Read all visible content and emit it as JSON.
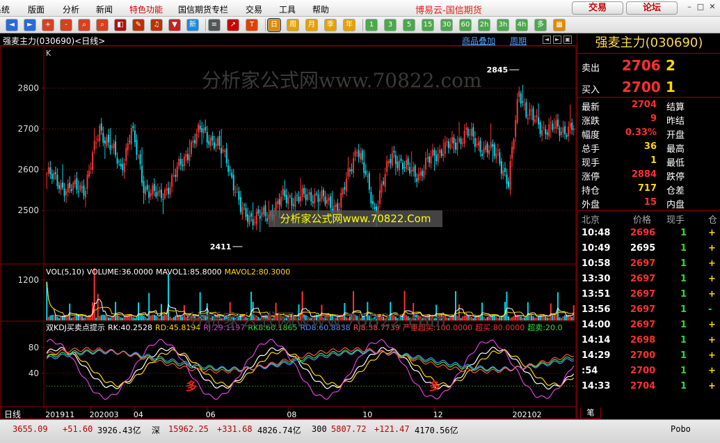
{
  "menu": [
    {
      "label": "系统",
      "x": -10
    },
    {
      "label": "版面",
      "x": 40
    },
    {
      "label": "分析",
      "x": 90
    },
    {
      "label": "新闻",
      "x": 138
    },
    {
      "label": "特色功能",
      "x": 186,
      "color": "#d00000"
    },
    {
      "label": "国信期货专栏",
      "x": 256
    },
    {
      "label": "交易",
      "x": 353
    },
    {
      "label": "工具",
      "x": 401
    },
    {
      "label": "帮助",
      "x": 449
    }
  ],
  "brand": "博易云-国信期货",
  "buttons": {
    "trade": "交易",
    "forum": "论坛"
  },
  "toolbar_icons": [
    {
      "name": "back-icon",
      "glyph": "◄",
      "color": "#2a6ad8"
    },
    {
      "name": "forward-icon",
      "glyph": "►",
      "color": "#2a6ad8"
    },
    {
      "name": "zoom-in-icon",
      "glyph": "+",
      "color": "#d84020"
    },
    {
      "name": "zoom-out-icon",
      "glyph": "-",
      "color": "#d84020"
    },
    {
      "name": "search-icon",
      "glyph": "⌕",
      "color": "#d84020"
    },
    {
      "name": "find-icon",
      "glyph": "⌕",
      "color": "#d84020"
    },
    {
      "name": "color-icon",
      "glyph": "◧",
      "color": "#b01010"
    },
    {
      "name": "pen-icon",
      "glyph": "✎",
      "color": "#c03000"
    },
    {
      "name": "alarm-icon",
      "glyph": "♫",
      "color": "#c03000"
    },
    {
      "name": "filter-icon",
      "glyph": "▼",
      "color": "#c82020"
    },
    {
      "name": "new-icon",
      "glyph": "新",
      "color": "#1b8ad8"
    },
    {
      "name": "list-icon",
      "glyph": "≡",
      "color": "#555"
    },
    {
      "name": "trend-icon",
      "glyph": "↗",
      "color": "#c00"
    },
    {
      "name": "tick-icon",
      "glyph": "T",
      "color": "#e04000"
    },
    {
      "name": "day-icon",
      "glyph": "日",
      "color": "#e08a00"
    },
    {
      "name": "week-icon",
      "glyph": "周",
      "color": "#e8a000"
    },
    {
      "name": "month-icon",
      "glyph": "月",
      "color": "#e8a000"
    },
    {
      "name": "season-icon",
      "glyph": "季",
      "color": "#e8a000"
    },
    {
      "name": "year-icon",
      "glyph": "年",
      "color": "#e8a000"
    },
    {
      "name": "min1-icon",
      "glyph": "1",
      "color": "#4ca84c"
    },
    {
      "name": "min3-icon",
      "glyph": "3",
      "color": "#4ca84c"
    },
    {
      "name": "min5-icon",
      "glyph": "5",
      "color": "#4ca84c"
    },
    {
      "name": "min15-icon",
      "glyph": "15",
      "color": "#4ca84c"
    },
    {
      "name": "min30-icon",
      "glyph": "30",
      "color": "#4ca84c"
    },
    {
      "name": "min60-icon",
      "glyph": "60",
      "color": "#4ca84c"
    },
    {
      "name": "hour2-icon",
      "glyph": "2h",
      "color": "#4ca84c"
    },
    {
      "name": "hour3-icon",
      "glyph": "3h",
      "color": "#4ca84c"
    },
    {
      "name": "hour4-icon",
      "glyph": "4h",
      "color": "#4ca84c"
    },
    {
      "name": "multi-icon",
      "glyph": "多",
      "color": "#4ca84c"
    },
    {
      "name": "layout-icon",
      "glyph": "▦",
      "color": "#e08a00"
    }
  ],
  "chart_header": {
    "title": "强麦主力(030690)<日线>",
    "links": [
      "商品叠加",
      "周期"
    ]
  },
  "watermark": {
    "badge": "分析家公式网www.70822.Com",
    "text1": "分析家公式网www.70822.com",
    "text2": "分析家公式网www.70822.com"
  },
  "colors": {
    "up": "#ff3232",
    "down": "#00d8e8",
    "red": "#ff3030",
    "green": "#2fdc2f",
    "yellow": "#ffd800",
    "frame": "#900000"
  },
  "chart_data": [
    {
      "type": "candlestick",
      "panel_label": "K",
      "ylim": [
        2370,
        2900
      ],
      "yticks": [
        2500,
        2600,
        2700,
        2800
      ],
      "annotations": [
        {
          "label": "2845",
          "value": 2845,
          "index": 268
        },
        {
          "label": "2411",
          "value": 2411,
          "index": 111
        }
      ],
      "anchors": [
        [
          0,
          2590
        ],
        [
          12,
          2550
        ],
        [
          22,
          2560
        ],
        [
          30,
          2700
        ],
        [
          36,
          2660
        ],
        [
          42,
          2600
        ],
        [
          48,
          2700
        ],
        [
          55,
          2560
        ],
        [
          64,
          2530
        ],
        [
          72,
          2580
        ],
        [
          82,
          2660
        ],
        [
          88,
          2700
        ],
        [
          94,
          2670
        ],
        [
          102,
          2630
        ],
        [
          110,
          2500
        ],
        [
          118,
          2480
        ],
        [
          126,
          2490
        ],
        [
          134,
          2530
        ],
        [
          145,
          2530
        ],
        [
          152,
          2540
        ],
        [
          158,
          2520
        ],
        [
          166,
          2510
        ],
        [
          176,
          2660
        ],
        [
          186,
          2500
        ],
        [
          196,
          2640
        ],
        [
          204,
          2600
        ],
        [
          212,
          2590
        ],
        [
          220,
          2640
        ],
        [
          230,
          2660
        ],
        [
          238,
          2690
        ],
        [
          248,
          2650
        ],
        [
          256,
          2640
        ],
        [
          262,
          2560
        ],
        [
          268,
          2800
        ],
        [
          272,
          2740
        ],
        [
          282,
          2700
        ],
        [
          300,
          2700
        ]
      ]
    },
    {
      "type": "bar",
      "panel_label": "VOL(5,10) VOLUME:36.0000 MAVOL1:85.8000 MAVOL2:80.3000",
      "legend": [
        {
          "name": "VOL(5,10) VOLUME:36.0000",
          "color": "#ffffff"
        },
        {
          "name": "MAVOL1:85.8000",
          "color": "#ffffff"
        },
        {
          "name": "MAVOL2:80.3000",
          "color": "#ffd800"
        }
      ],
      "yticks": [
        1200
      ],
      "ylim": [
        0,
        1650
      ]
    },
    {
      "type": "line",
      "panel_label": "双KDJ买卖点提示",
      "legend": [
        {
          "name": "双KDJ买卖点提示",
          "color": "#ffffff"
        },
        {
          "name": "RK:40.2528",
          "color": "#ffffff"
        },
        {
          "name": "RD:45.8194",
          "color": "#ffd800"
        },
        {
          "name": "RJ:29.1197",
          "color": "#e040e0"
        },
        {
          "name": "RK8:60.1865",
          "color": "#30e030"
        },
        {
          "name": "RD8:60.8838",
          "color": "#4f8fff"
        },
        {
          "name": "RJ8:58.7739",
          "color": "#ff5050"
        },
        {
          "name": "严重超买:100.0000",
          "color": "#ff3030"
        },
        {
          "name": "超买:80.0000",
          "color": "#ff3030"
        },
        {
          "name": "超卖:20.0",
          "color": "#30e030"
        }
      ],
      "ylim": [
        -10,
        120
      ],
      "yticks": [
        40,
        80
      ],
      "signals": [
        {
          "label": "多",
          "index": 82
        },
        {
          "label": "多",
          "index": 220
        }
      ]
    }
  ],
  "x_axis": {
    "label": "日线",
    "ticks": [
      {
        "label": "201911",
        "index": 0
      },
      {
        "label": "202003",
        "index": 25
      },
      {
        "label": "04",
        "index": 50
      },
      {
        "label": "06",
        "index": 91
      },
      {
        "label": "08",
        "index": 137
      },
      {
        "label": "10",
        "index": 180
      },
      {
        "label": "12",
        "index": 220
      },
      {
        "label": "202102",
        "index": 265
      }
    ]
  },
  "quote_panel": {
    "title": "强麦主力(030690)",
    "sell": {
      "label": "卖出",
      "price": "2706",
      "vol": "2"
    },
    "buy": {
      "label": "买入",
      "price": "2700",
      "vol": "1"
    },
    "rows": [
      {
        "l1": "最新",
        "v1": "2704",
        "c1": "#ff3030",
        "l2": "结算"
      },
      {
        "l1": "涨跌",
        "v1": "9",
        "c1": "#ff3030",
        "l2": "昨结"
      },
      {
        "l1": "幅度",
        "v1": "0.33%",
        "c1": "#ff3030",
        "l2": "开盘"
      },
      {
        "l1": "总手",
        "v1": "36",
        "c1": "#ffd800",
        "l2": "最高"
      },
      {
        "l1": "现手",
        "v1": "1",
        "c1": "#ffd800",
        "l2": "最低"
      },
      {
        "l1": "涨停",
        "v1": "2884",
        "c1": "#ff3030",
        "l2": "跌停"
      },
      {
        "l1": "持仓",
        "v1": "717",
        "c1": "#ffd800",
        "l2": "仓差"
      },
      {
        "l1": "外盘",
        "v1": "15",
        "c1": "#ff3030",
        "l2": "内盘"
      }
    ],
    "ticks_header": [
      "北京",
      "价格",
      "现手",
      "仓"
    ],
    "ticks": [
      {
        "time": "10:48",
        "price": "2696",
        "pc": "#ff3030",
        "vol": "1",
        "dir": "+",
        "dc": "#ffd800"
      },
      {
        "time": "10:49",
        "price": "2695",
        "pc": "#ffffff",
        "vol": "1",
        "dir": "+",
        "dc": "#ffd800"
      },
      {
        "time": "10:58",
        "price": "2697",
        "pc": "#ff3030",
        "vol": "1",
        "dir": "+",
        "dc": "#ffd800"
      },
      {
        "time": "13:30",
        "price": "2697",
        "pc": "#ff3030",
        "vol": "1",
        "dir": "+",
        "dc": "#ffd800"
      },
      {
        "time": "13:51",
        "price": "2697",
        "pc": "#ff3030",
        "vol": "1",
        "dir": "+",
        "dc": "#ffd800"
      },
      {
        "time": "13:56",
        "price": "2697",
        "pc": "#ff3030",
        "vol": "1",
        "dir": "-",
        "dc": "#30e030"
      },
      {
        "time": "14:00",
        "price": "2697",
        "pc": "#ff3030",
        "vol": "1",
        "dir": "+",
        "dc": "#ffd800"
      },
      {
        "time": "14:14",
        "price": "2698",
        "pc": "#ff3030",
        "vol": "1",
        "dir": "+",
        "dc": "#ffd800"
      },
      {
        "time": "14:29",
        "price": "2700",
        "pc": "#ff3030",
        "vol": "1",
        "dir": "+",
        "dc": "#ffd800"
      },
      {
        "time": ":54",
        "price": "2700",
        "pc": "#ff3030",
        "vol": "1",
        "dir": "+",
        "dc": "#ffd800"
      },
      {
        "time": "14:33",
        "price": "2704",
        "pc": "#ff3030",
        "vol": "1",
        "dir": "+",
        "dc": "#ffd800"
      }
    ],
    "tab": "笔"
  },
  "status": [
    {
      "text": "3655.09",
      "color": "#c00000",
      "x": 18
    },
    {
      "text": "+51.60",
      "color": "#c00000",
      "x": 90
    },
    {
      "text": "3926.43亿",
      "color": "#000",
      "x": 140
    },
    {
      "text": "深",
      "color": "#000",
      "x": 218
    },
    {
      "text": "15962.25",
      "color": "#c00000",
      "x": 242
    },
    {
      "text": "+331.68",
      "color": "#c00000",
      "x": 312
    },
    {
      "text": "4826.74亿",
      "color": "#000",
      "x": 370
    },
    {
      "text": "300",
      "color": "#000",
      "x": 448
    },
    {
      "text": "5807.72",
      "color": "#c00000",
      "x": 476
    },
    {
      "text": "+121.47",
      "color": "#c00000",
      "x": 538
    },
    {
      "text": "4170.56亿",
      "color": "#000",
      "x": 596
    },
    {
      "text": "Pobo",
      "color": "#000",
      "x": 964
    }
  ]
}
